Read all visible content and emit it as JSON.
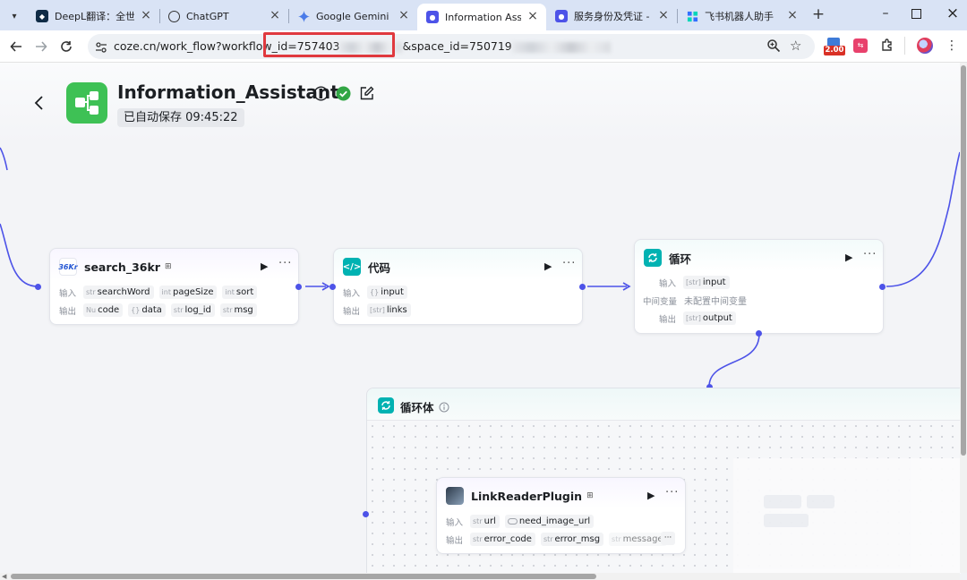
{
  "browser": {
    "tabs": [
      {
        "label": "DeepL翻译：全世界",
        "favicon": "deepl-icon",
        "active": false
      },
      {
        "label": "ChatGPT",
        "favicon": "chatgpt-icon",
        "active": false
      },
      {
        "label": "Google Gemini",
        "favicon": "gemini-icon",
        "active": false
      },
      {
        "label": "Information Assist",
        "favicon": "coze-icon",
        "active": true
      },
      {
        "label": "服务身份及凭证 - 扣",
        "favicon": "coze-icon",
        "active": false
      },
      {
        "label": "飞书机器人助手",
        "favicon": "feishu-icon",
        "active": false
      }
    ],
    "url_prefix": "coze.cn/work_flow?workflow_id=757403",
    "url_middle": "&space_id=750719",
    "extension_badge": "2.00",
    "colors": {
      "tabstrip": "#d9e3f5",
      "redbox": "#e0393e"
    }
  },
  "workflow": {
    "title": "Information_Assistant",
    "autosave": "已自动保存 09:45:22",
    "logo_color": "#3ec155"
  },
  "nodes": {
    "search": {
      "title": "search_36kr",
      "input_label": "输入",
      "output_label": "输出",
      "inputs": [
        {
          "type": "str",
          "name": "searchWord"
        },
        {
          "type": "int",
          "name": "pageSize"
        },
        {
          "type": "int",
          "name": "sort"
        }
      ],
      "outputs": [
        {
          "type": "Nu",
          "name": "code"
        },
        {
          "type": "{}",
          "name": "data"
        },
        {
          "type": "str",
          "name": "log_id"
        },
        {
          "type": "str",
          "name": "msg"
        }
      ]
    },
    "code": {
      "title": "代码",
      "input_label": "输入",
      "output_label": "输出",
      "inputs": [
        {
          "type": "{}",
          "name": "input"
        }
      ],
      "outputs": [
        {
          "type": "[str]",
          "name": "links"
        }
      ],
      "icon_color": "#00b2b2"
    },
    "loop": {
      "title": "循环",
      "input_label": "输入",
      "var_label": "中间变量",
      "var_value": "未配置中间变量",
      "output_label": "输出",
      "inputs": [
        {
          "type": "[str]",
          "name": "input"
        }
      ],
      "outputs": [
        {
          "type": "[str]",
          "name": "output"
        }
      ],
      "icon_color": "#00b2b2"
    },
    "loop_body": {
      "title": "循环体"
    },
    "linkreader": {
      "title": "LinkReaderPlugin",
      "input_label": "输入",
      "output_label": "输出",
      "inputs": [
        {
          "type": "str",
          "name": "url"
        },
        {
          "type": "bool",
          "name": "need_image_url"
        }
      ],
      "outputs": [
        {
          "type": "str",
          "name": "error_code"
        },
        {
          "type": "str",
          "name": "error_msg"
        },
        {
          "type": "str",
          "name": "message"
        }
      ],
      "overflow": "···"
    }
  }
}
